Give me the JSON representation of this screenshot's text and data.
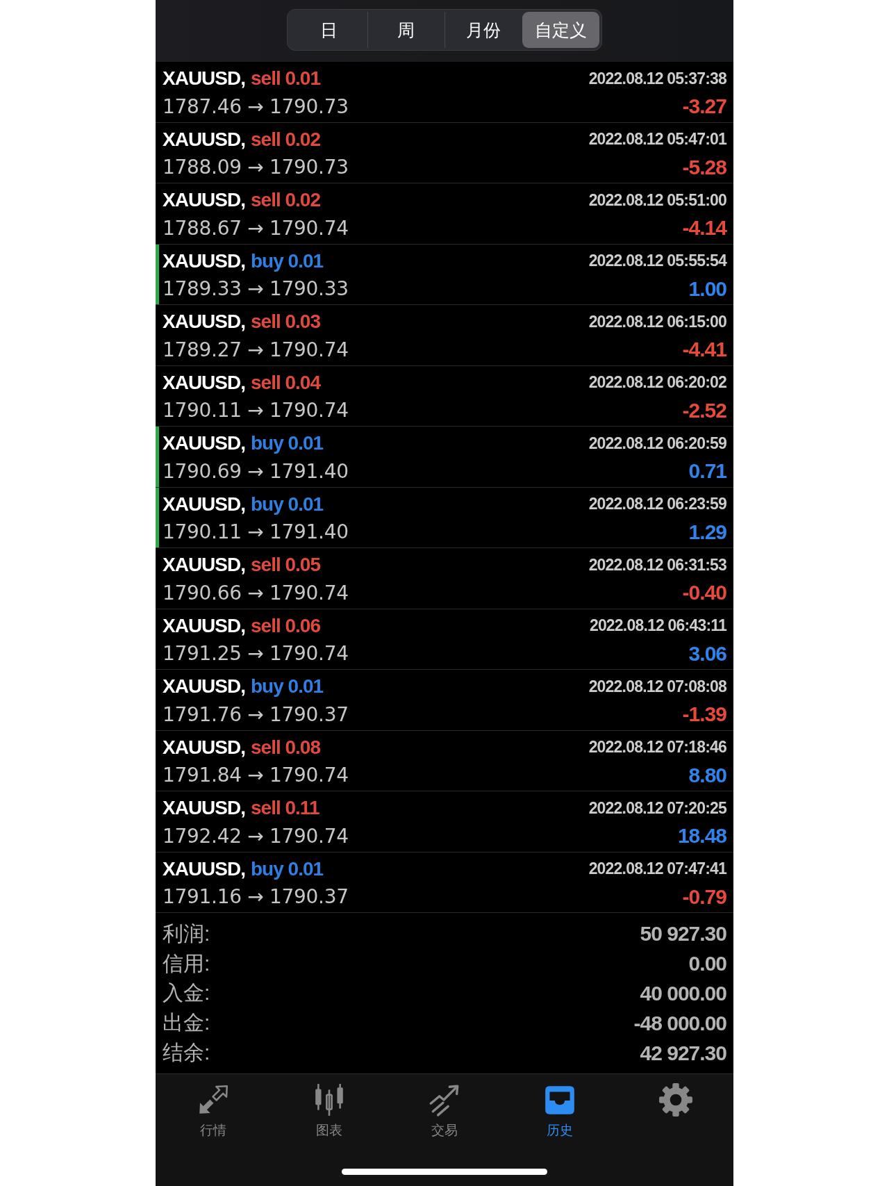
{
  "period_tabs": [
    {
      "label": "日",
      "selected": false
    },
    {
      "label": "周",
      "selected": false
    },
    {
      "label": "月份",
      "selected": false
    },
    {
      "label": "自定义",
      "selected": true
    }
  ],
  "trades": [
    {
      "symbol": "XAUUSD,",
      "order": {
        "text": "sell 0.01",
        "color": "#e0493d"
      },
      "prices": "1787.46 → 1790.73",
      "time": "2022.08.12 05:37:38",
      "profit": {
        "text": "-3.27",
        "color": "#e7493b"
      },
      "flagged": false
    },
    {
      "symbol": "XAUUSD,",
      "order": {
        "text": "sell 0.02",
        "color": "#e0493d"
      },
      "prices": "1788.09 → 1790.73",
      "time": "2022.08.12 05:47:01",
      "profit": {
        "text": "-5.28",
        "color": "#e7493b"
      },
      "flagged": false
    },
    {
      "symbol": "XAUUSD,",
      "order": {
        "text": "sell 0.02",
        "color": "#e0493d"
      },
      "prices": "1788.67 → 1790.74",
      "time": "2022.08.12 05:51:00",
      "profit": {
        "text": "-4.14",
        "color": "#e7493b"
      },
      "flagged": false
    },
    {
      "symbol": "XAUUSD,",
      "order": {
        "text": "buy 0.01",
        "color": "#2f7fe2"
      },
      "prices": "1789.33 → 1790.33",
      "time": "2022.08.12 05:55:54",
      "profit": {
        "text": "1.00",
        "color": "#2f83ea"
      },
      "flagged": true
    },
    {
      "symbol": "XAUUSD,",
      "order": {
        "text": "sell 0.03",
        "color": "#e0493d"
      },
      "prices": "1789.27 → 1790.74",
      "time": "2022.08.12 06:15:00",
      "profit": {
        "text": "-4.41",
        "color": "#e7493b"
      },
      "flagged": false
    },
    {
      "symbol": "XAUUSD,",
      "order": {
        "text": "sell 0.04",
        "color": "#e0493d"
      },
      "prices": "1790.11 → 1790.74",
      "time": "2022.08.12 06:20:02",
      "profit": {
        "text": "-2.52",
        "color": "#e7493b"
      },
      "flagged": false
    },
    {
      "symbol": "XAUUSD,",
      "order": {
        "text": "buy 0.01",
        "color": "#2f7fe2"
      },
      "prices": "1790.69 → 1791.40",
      "time": "2022.08.12 06:20:59",
      "profit": {
        "text": "0.71",
        "color": "#2f83ea"
      },
      "flagged": true
    },
    {
      "symbol": "XAUUSD,",
      "order": {
        "text": "buy 0.01",
        "color": "#2f7fe2"
      },
      "prices": "1790.11 → 1791.40",
      "time": "2022.08.12 06:23:59",
      "profit": {
        "text": "1.29",
        "color": "#2f83ea"
      },
      "flagged": true
    },
    {
      "symbol": "XAUUSD,",
      "order": {
        "text": "sell 0.05",
        "color": "#e0493d"
      },
      "prices": "1790.66 → 1790.74",
      "time": "2022.08.12 06:31:53",
      "profit": {
        "text": "-0.40",
        "color": "#e7493b"
      },
      "flagged": false
    },
    {
      "symbol": "XAUUSD,",
      "order": {
        "text": "sell 0.06",
        "color": "#e0493d"
      },
      "prices": "1791.25 → 1790.74",
      "time": "2022.08.12 06:43:11",
      "profit": {
        "text": "3.06",
        "color": "#2f83ea"
      },
      "flagged": false
    },
    {
      "symbol": "XAUUSD,",
      "order": {
        "text": "buy 0.01",
        "color": "#2f7fe2"
      },
      "prices": "1791.76 → 1790.37",
      "time": "2022.08.12 07:08:08",
      "profit": {
        "text": "-1.39",
        "color": "#e7493b"
      },
      "flagged": false
    },
    {
      "symbol": "XAUUSD,",
      "order": {
        "text": "sell 0.08",
        "color": "#e0493d"
      },
      "prices": "1791.84 → 1790.74",
      "time": "2022.08.12 07:18:46",
      "profit": {
        "text": "8.80",
        "color": "#2f83ea"
      },
      "flagged": false
    },
    {
      "symbol": "XAUUSD,",
      "order": {
        "text": "sell 0.11",
        "color": "#e0493d"
      },
      "prices": "1792.42 → 1790.74",
      "time": "2022.08.12 07:20:25",
      "profit": {
        "text": "18.48",
        "color": "#2f83ea"
      },
      "flagged": false
    },
    {
      "symbol": "XAUUSD,",
      "order": {
        "text": "buy 0.01",
        "color": "#2f7fe2"
      },
      "prices": "1791.16 → 1790.37",
      "time": "2022.08.12 07:47:41",
      "profit": {
        "text": "-0.79",
        "color": "#e7493b"
      },
      "flagged": false
    }
  ],
  "summary": [
    {
      "label": "利润:",
      "value": "50 927.30"
    },
    {
      "label": "信用:",
      "value": "0.00"
    },
    {
      "label": "入金:",
      "value": "40 000.00"
    },
    {
      "label": "出金:",
      "value": "-48 000.00"
    },
    {
      "label": "结余:",
      "value": "42 927.30"
    }
  ],
  "tab_bar": [
    {
      "kind": "quotes",
      "label": "行情",
      "selected": false
    },
    {
      "kind": "chart",
      "label": "图表",
      "selected": false
    },
    {
      "kind": "trade",
      "label": "交易",
      "selected": false
    },
    {
      "kind": "history",
      "label": "历史",
      "selected": true
    },
    {
      "kind": "settings",
      "selected": false
    }
  ]
}
